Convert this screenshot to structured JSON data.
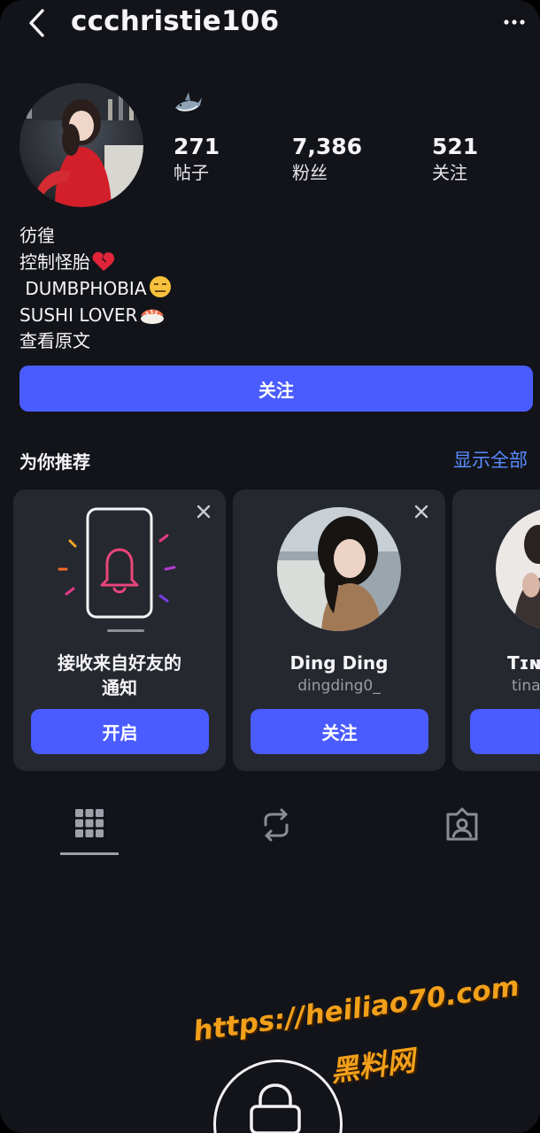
{
  "header": {
    "username": "ccchristie106",
    "back_icon": "chevron-left-icon",
    "more_icon": "ellipsis-horizontal-icon"
  },
  "profile": {
    "badge_icon": "shark-emoji-icon",
    "stats": [
      {
        "value": "271",
        "label": "帖子"
      },
      {
        "value": "7,386",
        "label": "粉丝"
      },
      {
        "value": "521",
        "label": "关注"
      }
    ],
    "bio_lines": [
      "彷徨",
      "控制怪胎",
      " DUMBPHOBIA",
      "SUSHI LOVER",
      "查看原文"
    ],
    "follow_label": "关注"
  },
  "recommendations": {
    "title": "为你推荐",
    "show_all": "显示全部",
    "cards": [
      {
        "title_line1": "接收来自好友的",
        "title_line2": "通知",
        "button": "开启",
        "icon": "phone-bell-icon"
      },
      {
        "name": "Ding Ding",
        "handle": "dingding0_",
        "button": "关注"
      },
      {
        "name": "Tɪɴ",
        "handle": "tina",
        "button": ""
      }
    ]
  },
  "tabs": [
    "grid-icon",
    "repost-icon",
    "tagged-person-icon"
  ],
  "watermark": {
    "url": "https://heiliao70.com",
    "site": "黑料网"
  },
  "colors": {
    "background": "#12141a",
    "card": "#262830",
    "accent_button": "#4a5cff",
    "link": "#5b8cff",
    "watermark": "#f2a01a"
  }
}
